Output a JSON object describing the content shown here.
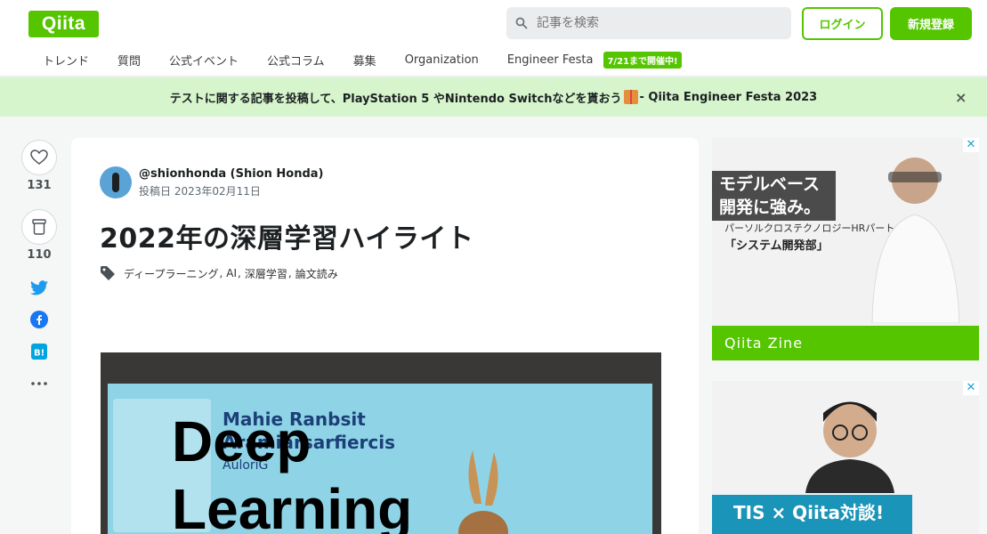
{
  "header": {
    "logo": "Qiita",
    "search_placeholder": "記事を検索",
    "login_label": "ログイン",
    "signup_label": "新規登録"
  },
  "nav": {
    "items": [
      "トレンド",
      "質問",
      "公式イベント",
      "公式コラム",
      "募集",
      "Organization",
      "Engineer Festa"
    ],
    "badge": "7/21まで開催中!"
  },
  "banner": {
    "text_before": "テストに関する記事を投稿して、PlayStation 5 やNintendo Switchなどを貰おう",
    "text_after": " - Qiita Engineer Festa 2023",
    "close": "×"
  },
  "sidebar": {
    "likes": "131",
    "stocks": "110"
  },
  "article": {
    "author": "@shionhonda (Shion Honda)",
    "posted": "投稿日 2023年02月11日",
    "title": "2022年の深層学習ハイライト",
    "tags": [
      "ディープラーニング",
      "AI",
      "深層学習",
      "論文読み"
    ],
    "hero_subtitle_1": "Mahie Ranbsit",
    "hero_subtitle_2": "Aramiarsarfiercis",
    "hero_subtitle_3": "AuloriG",
    "hero_big_1": "Deep",
    "hero_big_2": "Learning"
  },
  "ads": {
    "ad1_headline_1": "モデルベース",
    "ad1_headline_2": "開発に強み。",
    "ad1_sub1": "パーソルクロステクノロジーHRパートナーズの",
    "ad1_sub2": "「システム開発部」",
    "ad1_footer": "Qiita Zine",
    "ad2_footer": "TIS × Qiita対談!",
    "close": "✕"
  },
  "colors": {
    "brand": "#55c500",
    "banner_bg": "#d6f5cc"
  }
}
